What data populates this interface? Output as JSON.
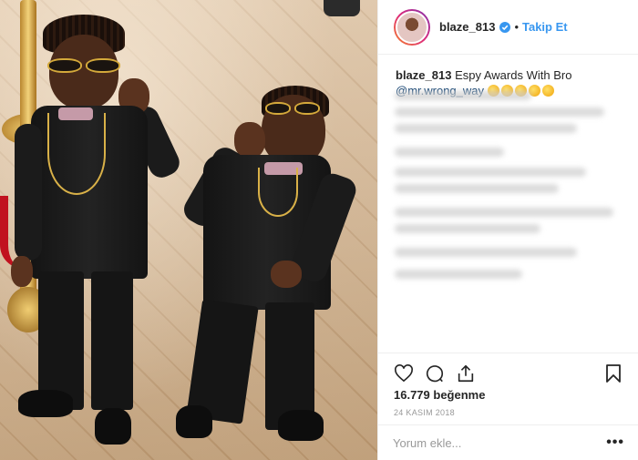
{
  "header": {
    "username": "blaze_813",
    "follow_label": "Takip Et",
    "separator": "•"
  },
  "caption": {
    "username": "blaze_813",
    "text": "Espy Awards With Bro",
    "mention": "@mr.wrong_way",
    "emoji_count": 5
  },
  "stats": {
    "likes": "16.779 beğenme",
    "date": "24 KASIM 2018"
  },
  "comment": {
    "placeholder": "Yorum ekle...",
    "more_label": "•••"
  },
  "colors": {
    "accent": "#3897f0",
    "mention": "#003569",
    "verified": "#3897f0",
    "text": "#262626",
    "muted": "#999999"
  },
  "icons": [
    "verified-badge-icon",
    "heart-icon",
    "comment-icon",
    "share-icon",
    "bookmark-icon",
    "more-options-icon"
  ]
}
